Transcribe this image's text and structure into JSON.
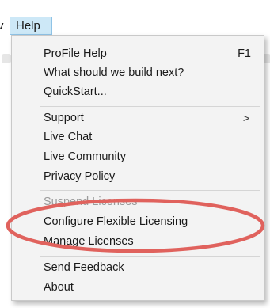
{
  "menubar": {
    "prev_fragment": "v",
    "active_menu": "Help"
  },
  "dropdown": {
    "groups": [
      {
        "items": [
          {
            "label": "ProFile Help",
            "shortcut": "F1"
          },
          {
            "label": "What should we build next?"
          },
          {
            "label": "QuickStart..."
          }
        ]
      },
      {
        "items": [
          {
            "label": "Support",
            "submenu": true
          },
          {
            "label": "Live Chat"
          },
          {
            "label": "Live Community"
          },
          {
            "label": "Privacy Policy"
          }
        ]
      },
      {
        "items": [
          {
            "label": "Suspend Licenses",
            "disabled": true
          },
          {
            "label": "Configure Flexible Licensing"
          },
          {
            "label": "Manage Licenses"
          }
        ]
      },
      {
        "items": [
          {
            "label": "Send Feedback"
          },
          {
            "label": "About"
          }
        ]
      }
    ],
    "submenu_glyph": ">"
  },
  "annotation": {
    "shape": "ellipse",
    "color": "#e0625d",
    "highlights": "Configure Flexible Licensing"
  }
}
